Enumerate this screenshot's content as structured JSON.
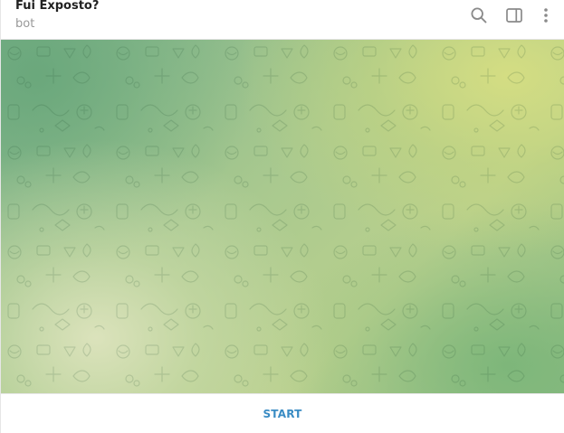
{
  "header": {
    "title": "Fui Exposto?",
    "subtitle": "bot",
    "icons": [
      "search-icon",
      "sidebar-toggle-icon",
      "more-vertical-icon"
    ]
  },
  "chat": {
    "background": "wallpaper-pattern-green"
  },
  "bottom_bar": {
    "start_label": "START"
  },
  "colors": {
    "accent": "#3a8cc4",
    "wallpaper_base": "#a9c98f"
  }
}
